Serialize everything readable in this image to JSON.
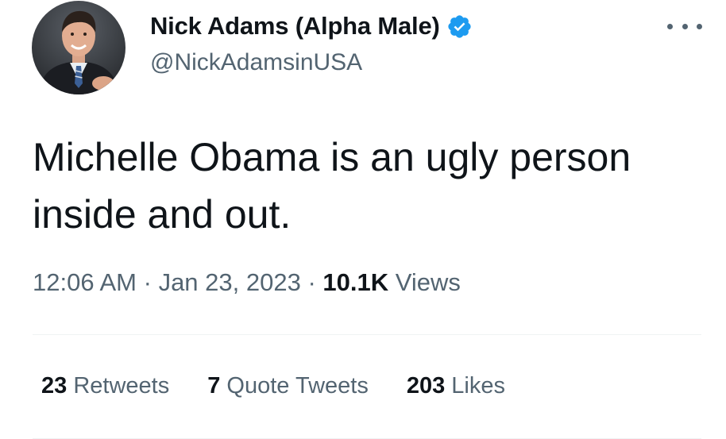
{
  "author": {
    "display_name": "Nick Adams (Alpha Male)",
    "handle": "@NickAdamsinUSA",
    "verified": true
  },
  "icons": {
    "verified": "verified-badge-icon",
    "more": "more-options-icon",
    "avatar": "profile-photo"
  },
  "colors": {
    "verified_blue": "#1d9bf0",
    "secondary_text": "#536471",
    "primary_text": "#0f1419",
    "divider": "#eff3f4"
  },
  "tweet": {
    "text": "Michelle Obama is an ugly person\ninside and out.",
    "time": "12:06 AM",
    "separator": "·",
    "date": "Jan 23, 2023",
    "views_count": "10.1K",
    "views_label": "Views"
  },
  "stats": {
    "retweets_count": "23",
    "retweets_label": "Retweets",
    "quotes_count": "7",
    "quotes_label": "Quote Tweets",
    "likes_count": "203",
    "likes_label": "Likes"
  }
}
